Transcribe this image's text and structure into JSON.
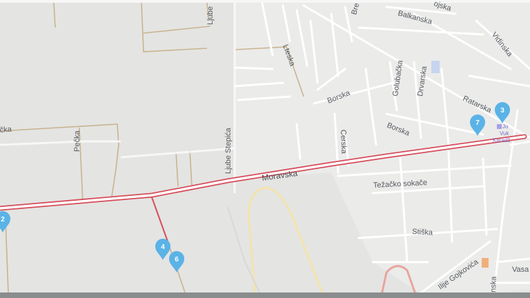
{
  "streets": {
    "moravska": "Moravska",
    "ljube_stepica": "Ljube Stepića",
    "ljube_top": "Ljube",
    "peska": "Pečka",
    "pecka_left": "čka",
    "borska_1": "Borska",
    "borska_2": "Borska",
    "cerska": "Cerska",
    "lteska": "Lteska",
    "golubacka": "Golubačka",
    "drvarska": "Drvarska",
    "balkanska": "Balkanska",
    "vidinska": "Vidinska",
    "rataraska": "Ratarska",
    "sojska": "ojska",
    "bre": "Bre",
    "tezacko": "Težačko sokače",
    "stiska": "Stiška",
    "ilije": "Ilije Gojkovića",
    "vasa": "Vasa",
    "nska": "nska"
  },
  "poi": {
    "line1": "Jo",
    "line2": "Vuk",
    "line3": "Karadž"
  },
  "markers": [
    {
      "label": "2"
    },
    {
      "label": "3"
    },
    {
      "label": "4"
    },
    {
      "label": "6"
    },
    {
      "label": "7"
    }
  ],
  "colors": {
    "land": "#e4e4e2",
    "residential": "#ededeb",
    "road": "#ffffff",
    "main_road": "#d64c5a",
    "track_outer": "#f3d99a",
    "track_red": "#e8a59e",
    "marker": "#5ab3e6",
    "poi_purple": "#a7a0e8",
    "orange_poi": "#f0b07a"
  }
}
